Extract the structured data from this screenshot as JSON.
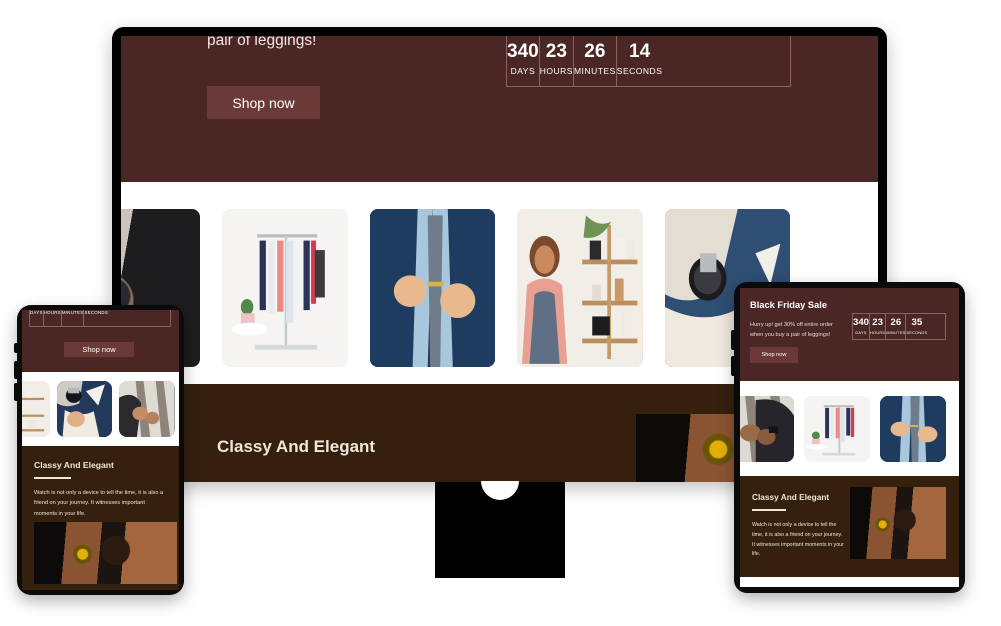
{
  "brand_colors": {
    "hero_maroon": "#4a2724",
    "feature_brown": "#35200e",
    "button_maroon": "#6b3a38",
    "device_frame_black": "#000000",
    "page_background": "#ffffff"
  },
  "promo": {
    "heading": "Black Friday Sale",
    "description": "Hurry up! get 30% off entire order when you buy a pair of leggings!",
    "description_tail": "pair of leggings!",
    "cta_label": "Shop now"
  },
  "countdown": {
    "desktop": [
      {
        "value": "340",
        "label": "DAYS"
      },
      {
        "value": "23",
        "label": "HOURS"
      },
      {
        "value": "26",
        "label": "MINUTES"
      },
      {
        "value": "14",
        "label": "SECONDS"
      }
    ],
    "tablet": [
      {
        "value": "340",
        "label": "DAYS"
      },
      {
        "value": "23",
        "label": "HOURS"
      },
      {
        "value": "26",
        "label": "MINUTES"
      },
      {
        "value": "35",
        "label": "SECONDS"
      }
    ],
    "phone": [
      {
        "value": "",
        "label": "DAYS"
      },
      {
        "value": "",
        "label": "HOURS"
      },
      {
        "value": "",
        "label": "MINUTES"
      },
      {
        "value": "",
        "label": "SECONDS"
      }
    ]
  },
  "gallery": {
    "desktop": [
      {
        "name": "man-adjusting-dark-watch-photo",
        "style": "ph-watchdark"
      },
      {
        "name": "clothing-rack-dresses-photo",
        "style": "ph-rack"
      },
      {
        "name": "man-buttoning-suit-tie-photo",
        "style": "ph-suit"
      },
      {
        "name": "woman-in-apron-shop-photo",
        "style": "ph-shop"
      },
      {
        "name": "wrist-watch-blue-suit-photo",
        "style": "ph-wristwatch"
      }
    ],
    "phone": [
      {
        "name": "woman-in-apron-shop-photo",
        "style": "ph-shop"
      },
      {
        "name": "pocket-square-suit-photo",
        "style": "ph-pocket"
      },
      {
        "name": "suspenders-hands-photo",
        "style": "ph-suspenders"
      }
    ],
    "tablet": [
      {
        "name": "suspenders-hands-photo",
        "style": "ph-suspenders"
      },
      {
        "name": "clothing-rack-dresses-photo",
        "style": "ph-rack"
      },
      {
        "name": "man-buttoning-suit-tie-photo",
        "style": "ph-suit"
      }
    ]
  },
  "feature": {
    "title": "Classy And Elegant",
    "paragraph": "Watch is not only a device to tell the time, it is also a friend on your journey. It witnesses important moments in your life.",
    "image_name": "hand-on-steering-wheel-watch-photo"
  },
  "devices": {
    "desktop_label": "desktop-monitor",
    "phone_label": "mobile-phone",
    "tablet_label": "tablet"
  }
}
